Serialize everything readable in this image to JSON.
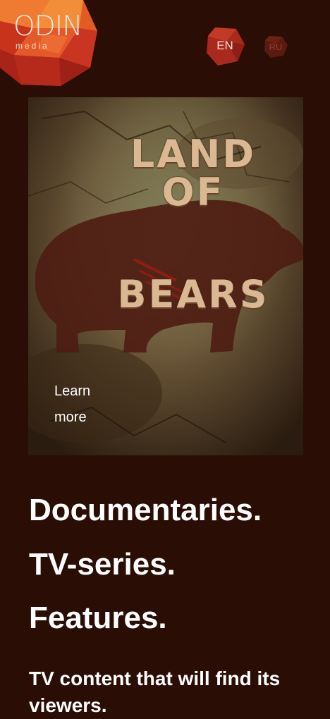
{
  "brand": {
    "name": "ODIN",
    "sub": "media"
  },
  "lang": {
    "en": "EN",
    "ru": "RU"
  },
  "poster": {
    "title_line1": "LAND OF",
    "title_line2": "BEARS",
    "cta": "Learn more"
  },
  "hero": {
    "line1": "Documentaries.",
    "line2": "TV-series.",
    "line3": "Features.",
    "tagline": "TV content that will find its viewers."
  },
  "colors": {
    "background": "#2a0e06",
    "logo_orange": "#e8602a",
    "logo_red": "#b8281c",
    "lang_badge": "#a52a1e",
    "text": "#ffffff"
  },
  "icons": {
    "logo": "polygon-sphere-logo",
    "lang_badge": "polygon-badge"
  }
}
